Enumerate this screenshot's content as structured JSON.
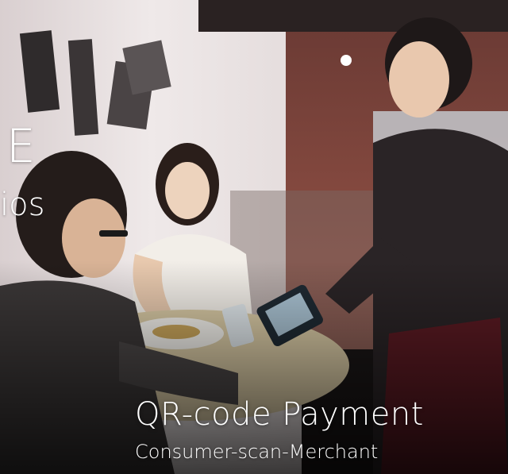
{
  "slide": {
    "edge_text_top": "E",
    "edge_text_bottom": "ios",
    "title": "QR-code Payment",
    "subtitle": "Consumer-scan-Merchant"
  },
  "photo": {
    "description_icon": "restaurant-payment-photo",
    "colors": {
      "wall": "#e6dede",
      "brick": "#8a4a40",
      "shirt": "#2a2426",
      "apron": "#5a1a22",
      "skin": "#e9c9ae",
      "table": "#d9c8a0"
    }
  }
}
